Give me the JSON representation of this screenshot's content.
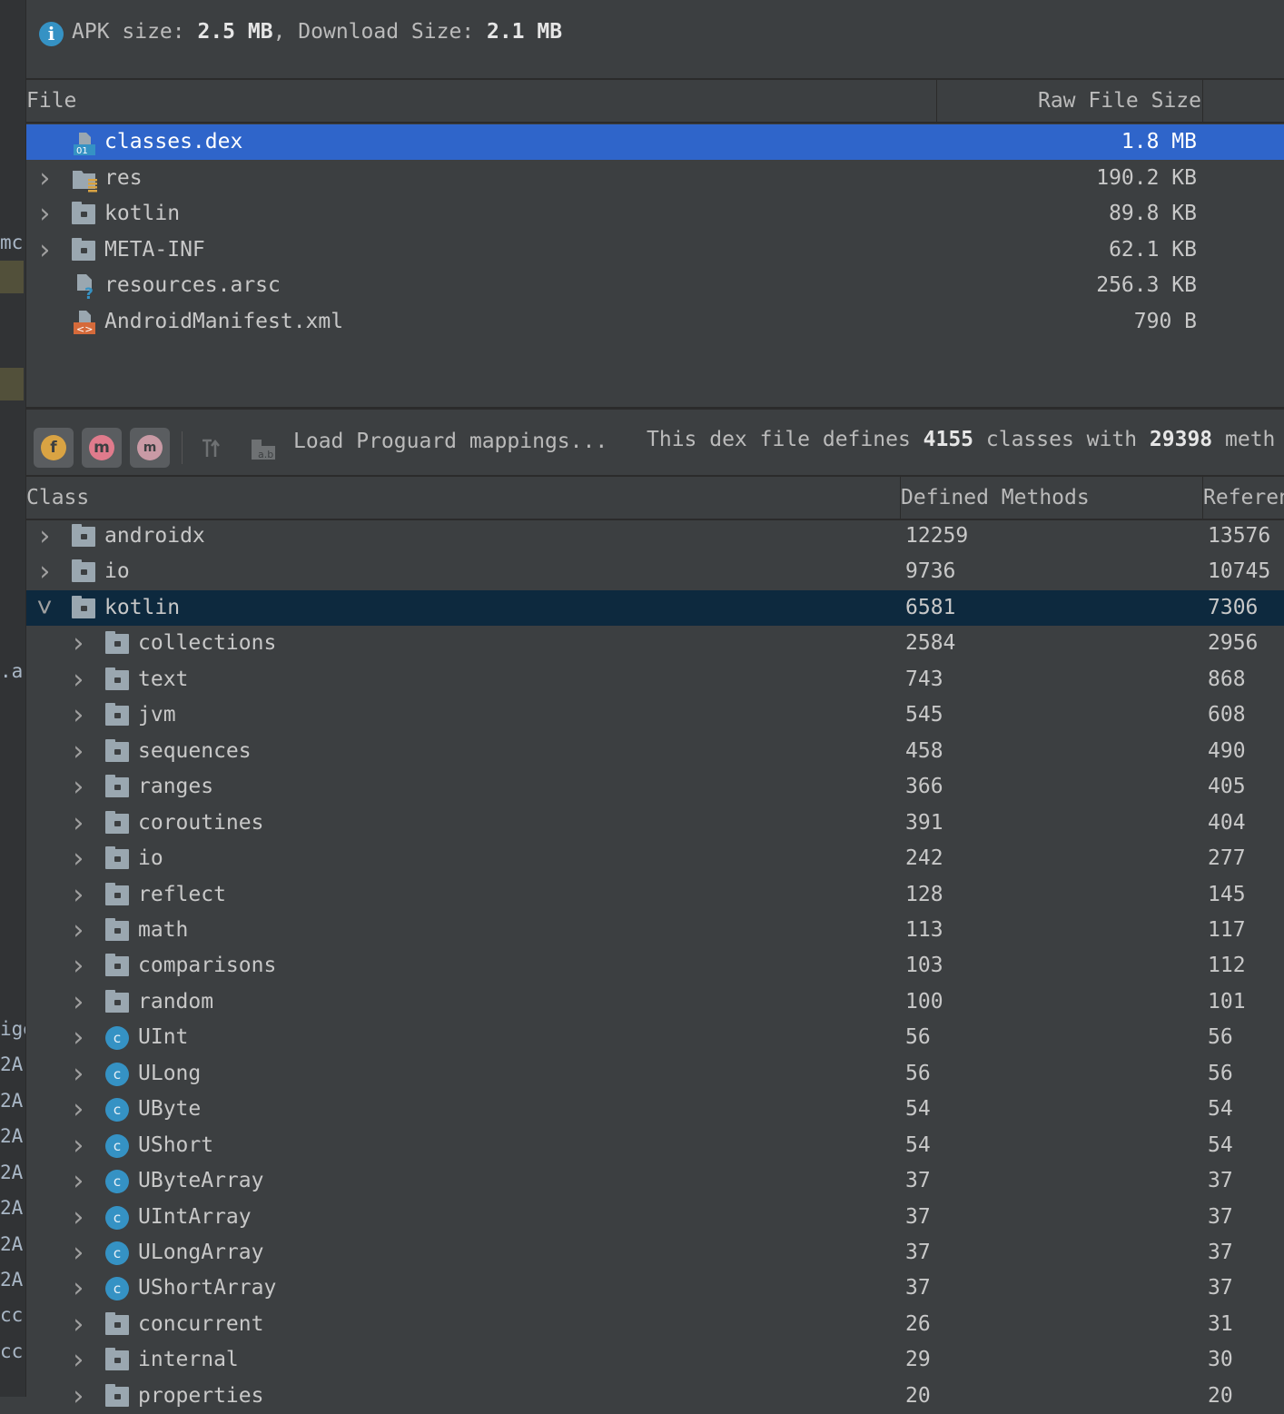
{
  "gutter": {
    "labels": [
      "mc",
      ".a",
      "ige",
      "2A",
      "2A",
      "2A",
      "2A",
      "2A",
      "2A",
      "2A",
      "cc",
      "cc"
    ]
  },
  "info": {
    "apk_label": "APK size: ",
    "apk_size": "2.5 MB",
    "download_label": ", Download Size: ",
    "download_size": "2.1 MB"
  },
  "file_table": {
    "col_file": "File",
    "col_size": "Raw File Size",
    "rows": [
      {
        "name": "classes.dex",
        "size": "1.8 MB",
        "icon": "dex-file-icon"
      },
      {
        "name": "res",
        "size": "190.2 KB",
        "icon": "res-folder-icon"
      },
      {
        "name": "kotlin",
        "size": "89.8 KB",
        "icon": "folder-icon"
      },
      {
        "name": "META-INF",
        "size": "62.1 KB",
        "icon": "folder-icon"
      },
      {
        "name": "resources.arsc",
        "size": "256.3 KB",
        "icon": "unknown-file-icon"
      },
      {
        "name": "AndroidManifest.xml",
        "size": "790 B",
        "icon": "xml-file-icon"
      }
    ]
  },
  "toolbar": {
    "btn_f": "f",
    "btn_m": "m",
    "btn_mf": "m",
    "load_proguard": "Load Proguard mappings...",
    "summary_prefix": "This dex file defines ",
    "classes_count": "4155",
    "summary_mid": " classes with ",
    "methods_count": "29398",
    "summary_suffix": " meth"
  },
  "class_table": {
    "col_class": "Class",
    "col_defined": "Defined Methods",
    "col_referenced": "Referen",
    "rows": [
      {
        "name": "androidx",
        "defined": "12259",
        "referenced": "13576",
        "level": 0,
        "kind": "package",
        "expanded": false
      },
      {
        "name": "io",
        "defined": "9736",
        "referenced": "10745",
        "level": 0,
        "kind": "package",
        "expanded": false
      },
      {
        "name": "kotlin",
        "defined": "6581",
        "referenced": "7306",
        "level": 0,
        "kind": "package",
        "expanded": true
      },
      {
        "name": "collections",
        "defined": "2584",
        "referenced": "2956",
        "level": 1,
        "kind": "package"
      },
      {
        "name": "text",
        "defined": "743",
        "referenced": "868",
        "level": 1,
        "kind": "package"
      },
      {
        "name": "jvm",
        "defined": "545",
        "referenced": "608",
        "level": 1,
        "kind": "package"
      },
      {
        "name": "sequences",
        "defined": "458",
        "referenced": "490",
        "level": 1,
        "kind": "package"
      },
      {
        "name": "ranges",
        "defined": "366",
        "referenced": "405",
        "level": 1,
        "kind": "package"
      },
      {
        "name": "coroutines",
        "defined": "391",
        "referenced": "404",
        "level": 1,
        "kind": "package"
      },
      {
        "name": "io",
        "defined": "242",
        "referenced": "277",
        "level": 1,
        "kind": "package"
      },
      {
        "name": "reflect",
        "defined": "128",
        "referenced": "145",
        "level": 1,
        "kind": "package"
      },
      {
        "name": "math",
        "defined": "113",
        "referenced": "117",
        "level": 1,
        "kind": "package"
      },
      {
        "name": "comparisons",
        "defined": "103",
        "referenced": "112",
        "level": 1,
        "kind": "package"
      },
      {
        "name": "random",
        "defined": "100",
        "referenced": "101",
        "level": 1,
        "kind": "package"
      },
      {
        "name": "UInt",
        "defined": "56",
        "referenced": "56",
        "level": 1,
        "kind": "class"
      },
      {
        "name": "ULong",
        "defined": "56",
        "referenced": "56",
        "level": 1,
        "kind": "class"
      },
      {
        "name": "UByte",
        "defined": "54",
        "referenced": "54",
        "level": 1,
        "kind": "class"
      },
      {
        "name": "UShort",
        "defined": "54",
        "referenced": "54",
        "level": 1,
        "kind": "class"
      },
      {
        "name": "UByteArray",
        "defined": "37",
        "referenced": "37",
        "level": 1,
        "kind": "class"
      },
      {
        "name": "UIntArray",
        "defined": "37",
        "referenced": "37",
        "level": 1,
        "kind": "class"
      },
      {
        "name": "ULongArray",
        "defined": "37",
        "referenced": "37",
        "level": 1,
        "kind": "class"
      },
      {
        "name": "UShortArray",
        "defined": "37",
        "referenced": "37",
        "level": 1,
        "kind": "class"
      },
      {
        "name": "concurrent",
        "defined": "26",
        "referenced": "31",
        "level": 1,
        "kind": "package"
      },
      {
        "name": "internal",
        "defined": "29",
        "referenced": "30",
        "level": 1,
        "kind": "package"
      },
      {
        "name": "properties",
        "defined": "20",
        "referenced": "20",
        "level": 1,
        "kind": "package"
      }
    ]
  },
  "colors": {
    "background": "#3c3f41",
    "selection": "#2f65ca",
    "selection_inactive": "#0d293e",
    "info_icon": "#3592c4",
    "class_icon": "#3592c4"
  }
}
